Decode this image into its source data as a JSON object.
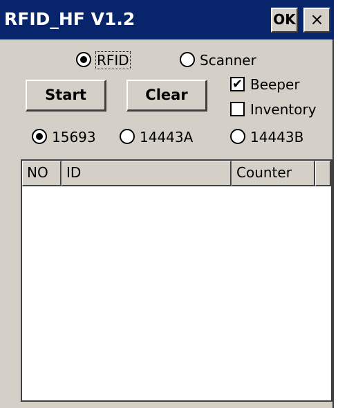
{
  "window": {
    "title": "RFID_HF V1.2",
    "ok_label": "OK",
    "close_label": "×"
  },
  "mode": {
    "options": [
      {
        "label": "RFID",
        "selected": true
      },
      {
        "label": "Scanner",
        "selected": false
      }
    ]
  },
  "buttons": {
    "start_label": "Start",
    "clear_label": "Clear"
  },
  "checkboxes": {
    "beeper": {
      "label": "Beeper",
      "checked": true,
      "mark": "✔"
    },
    "inventory": {
      "label": "Inventory",
      "checked": false,
      "mark": ""
    }
  },
  "protocol": {
    "options": [
      {
        "label": "15693",
        "selected": true
      },
      {
        "label": "14443A",
        "selected": false
      },
      {
        "label": "14443B",
        "selected": false
      }
    ]
  },
  "table": {
    "columns": [
      "NO",
      "ID",
      "Counter",
      ""
    ],
    "rows": []
  },
  "colors": {
    "titlebar": "#08246b",
    "face": "#d4d0c8"
  }
}
